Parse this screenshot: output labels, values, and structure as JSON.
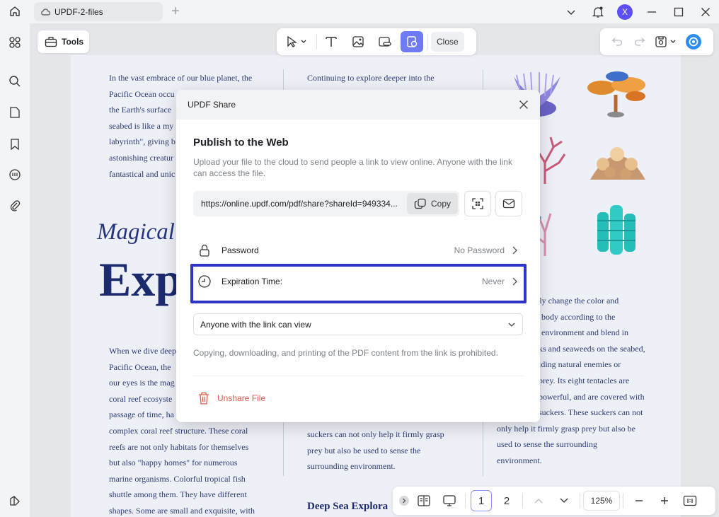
{
  "tab": {
    "title": "UPDF-2-files"
  },
  "user": {
    "initial": "X"
  },
  "toolbar": {
    "tools_label": "Tools",
    "close_label": "Close"
  },
  "document": {
    "col1_top": [
      "In the vast embrace of our blue planet, the",
      "Pacific Ocean occu",
      "the Earth's surface",
      "seabed is like a my",
      "labyrinth\", giving b",
      "astonishing creatur",
      "fantastical and unic"
    ],
    "col2_top": [
      "Continuing to explore deeper into the"
    ],
    "heading_magical": "Magical",
    "heading_exp": "Exp",
    "col1_bottom": [
      "When we dive deep",
      "Pacific Ocean, the",
      "our eyes is the mag",
      "coral reef ecosyste",
      "passage of time, ha",
      "complex coral reef structure. These coral",
      "reefs are not only habitats for themselves",
      "but also \"happy homes\" for numerous",
      "marine organisms. Colorful tropical fish",
      "shuttle among them. They have different",
      "shapes. Some are small and exquisite, with"
    ],
    "col2_bottom": [
      "suckers can not only help it firmly grasp",
      "prey but also be used to sense the",
      "surrounding environment."
    ],
    "col3_bottom": [
      "tly change the color and",
      "body according to the",
      "environment and blend in",
      "ks and seaweeds on the seabed,",
      "iding natural enemies or",
      "prey. Its eight tentacles are",
      "powerful, and are covered with",
      "suckers. These suckers can not",
      "only help it firmly grasp prey but also be",
      "used to sense the surrounding",
      "environment."
    ],
    "deep_sea_heading": "Deep Sea Explora"
  },
  "modal": {
    "header": "UPDF Share",
    "title": "Publish to the Web",
    "description": "Upload your file to the cloud to send people a link to view online. Anyone with the link can access the file.",
    "link": "https://online.updf.com/pdf/share?shareId=949334...",
    "copy_label": "Copy",
    "password_label": "Password",
    "password_value": "No Password",
    "expiration_label": "Expiration Time:",
    "expiration_value": "Never",
    "access_option": "Anyone with the link can view",
    "note": "Copying, downloading, and printing of the PDF content from the link is prohibited.",
    "unshare_label": "Unshare File"
  },
  "bottombar": {
    "page1": "1",
    "page2": "2",
    "zoom": "125%"
  },
  "colors": {
    "accent": "#6e7bf2",
    "highlight": "#2f34c8",
    "danger": "#e05a4e",
    "doc_text": "#2b3c72"
  }
}
